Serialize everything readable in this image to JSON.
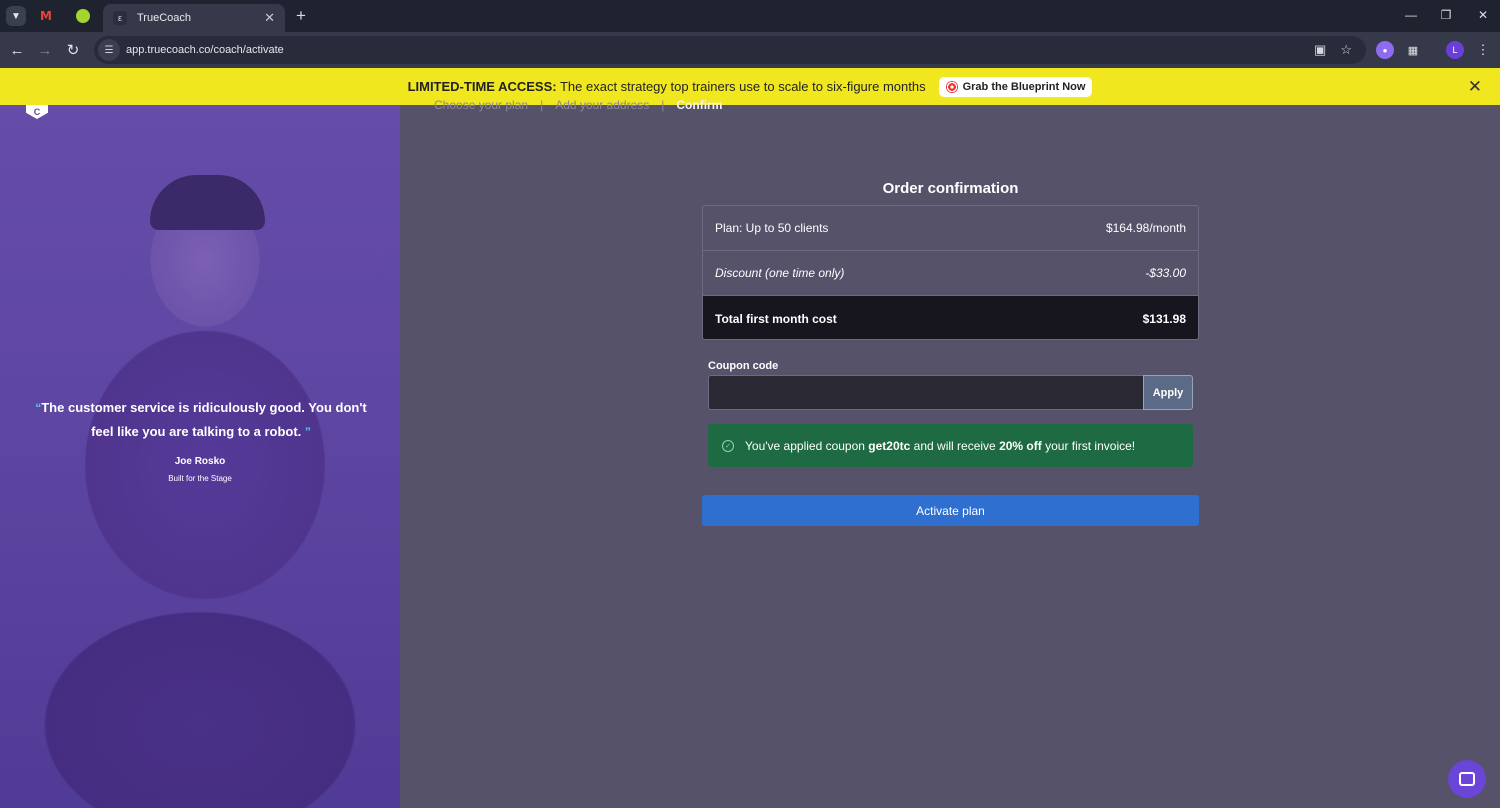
{
  "browser": {
    "tab_title": "TrueCoach",
    "url": "app.truecoach.co/coach/activate",
    "profile_initial": "L"
  },
  "icons": {
    "tab_list": "chevron-down-icon",
    "gmail": "gmail-icon",
    "pinned_app": "app-icon",
    "truecoach": "truecoach-icon",
    "close": "close-icon",
    "new_tab": "plus-icon",
    "back": "arrow-left-icon",
    "forward": "arrow-right-icon",
    "reload": "reload-icon",
    "site_info": "tune-icon",
    "install": "install-icon",
    "bookmark": "star-icon",
    "extension": "extension-icon",
    "extensions": "puzzle-icon",
    "menu": "kebab-icon",
    "target": "target-icon",
    "check": "check-circle-icon",
    "chat": "chat-icon"
  },
  "promo": {
    "label": "LIMITED-TIME ACCESS:",
    "text": "The exact strategy top trainers use to scale to six-figure months",
    "button": "Grab the Blueprint Now"
  },
  "testimonial": {
    "open_mark": "“",
    "quote": "The customer service is ridiculously good. You don't feel like you are talking to a robot.",
    "close_mark": "”",
    "author": "Joe Rosko",
    "author_business": "Built for the Stage"
  },
  "steps": [
    "Choose your plan",
    "Add your address",
    "Confirm"
  ],
  "order": {
    "heading": "Order confirmation",
    "plan_label": "Plan: Up to 50 clients",
    "plan_price": "$164.98/month",
    "discount_label": "Discount (one time only)",
    "discount_value": "-$33.00",
    "total_label": "Total first month cost",
    "total_value": "$131.98"
  },
  "coupon": {
    "label": "Coupon code",
    "value": "",
    "apply_label": "Apply",
    "success_prefix": "You've applied coupon",
    "code": "get20tc",
    "success_middle": "and will receive",
    "discount": "20% off",
    "success_suffix": "your first invoice!"
  },
  "activate_label": "Activate plan",
  "colors": {
    "promo_bg": "#f1e71f",
    "main_bg": "#56526a",
    "panel_tint": "#6550aa",
    "success_bg": "#1d6a43",
    "primary": "#2f6fd0",
    "chat": "#6a45d8"
  }
}
